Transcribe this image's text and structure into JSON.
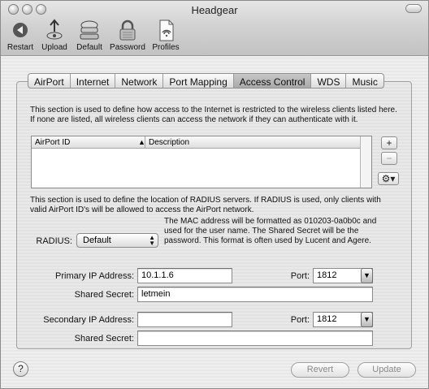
{
  "window": {
    "title": "Headgear"
  },
  "toolbar": {
    "items": [
      {
        "label": "Restart",
        "icon": "restart-icon"
      },
      {
        "label": "Upload",
        "icon": "upload-icon"
      },
      {
        "label": "Default",
        "icon": "default-icon"
      },
      {
        "label": "Password",
        "icon": "lock-icon"
      },
      {
        "label": "Profiles",
        "icon": "profiles-icon"
      }
    ]
  },
  "tabs": [
    {
      "label": "AirPort",
      "active": false
    },
    {
      "label": "Internet",
      "active": false
    },
    {
      "label": "Network",
      "active": false
    },
    {
      "label": "Port Mapping",
      "active": false
    },
    {
      "label": "Access Control",
      "active": true
    },
    {
      "label": "WDS",
      "active": false
    },
    {
      "label": "Music",
      "active": false
    }
  ],
  "access": {
    "description": "This section is used to define how access to the Internet is restricted to the wireless clients listed here. If none are listed, all wireless clients can access the network if they can authenticate with it.",
    "columns": [
      "AirPort ID",
      "Description"
    ],
    "sort_arrow": "▲",
    "add_label": "+",
    "remove_label": "−"
  },
  "radius": {
    "description": "This section is used to define the location of RADIUS servers. If RADIUS is used, only clients with valid AirPort ID's will be allowed to access the AirPort network.",
    "note": "The MAC address will be formatted as 010203-0a0b0c and used for the user name. The Shared Secret will be the password. This format is often used by Lucent and Agere.",
    "label": "RADIUS:",
    "value": "Default",
    "primary_ip_label": "Primary IP Address:",
    "primary_ip": "10.1.1.6",
    "port_label": "Port:",
    "primary_port": "1812",
    "secret_label": "Shared Secret:",
    "primary_secret": "letmein",
    "secondary_ip_label": "Secondary IP Address:",
    "secondary_ip": "",
    "secondary_port": "1812",
    "secondary_secret": ""
  },
  "footer": {
    "help_label": "?",
    "revert_label": "Revert",
    "update_label": "Update"
  },
  "colors": {
    "window_bg": "#ececec",
    "active_tab": "#b4b4b4"
  }
}
